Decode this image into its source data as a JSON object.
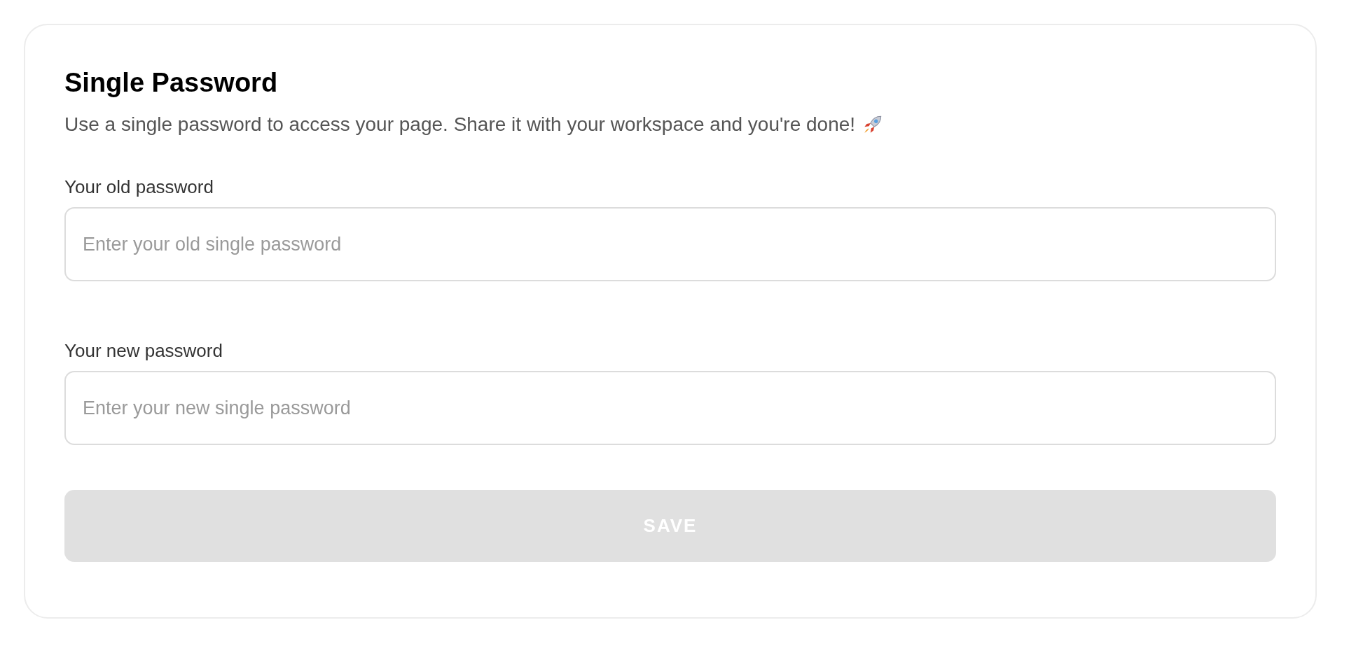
{
  "card": {
    "title": "Single Password",
    "description": "Use a single password to access your page. Share it with your workspace and you're done!"
  },
  "fields": [
    {
      "label": "Your old password",
      "placeholder": "Enter your old single password"
    },
    {
      "label": "Your new password",
      "placeholder": "Enter your new single password"
    }
  ],
  "save_button": {
    "label": "SAVE",
    "disabled": true
  }
}
